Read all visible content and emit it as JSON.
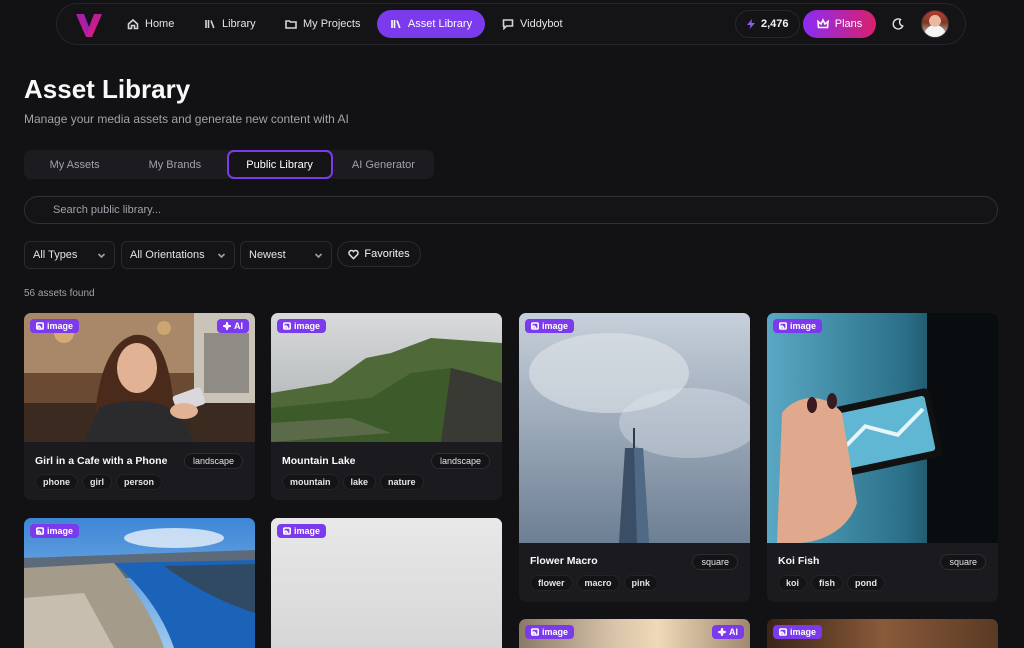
{
  "nav": {
    "items": [
      {
        "label": "Home",
        "icon": "home-icon"
      },
      {
        "label": "Library",
        "icon": "library-icon"
      },
      {
        "label": "My Projects",
        "icon": "folder-icon"
      },
      {
        "label": "Asset Library",
        "icon": "library-icon"
      },
      {
        "label": "Viddybot",
        "icon": "chat-icon"
      }
    ],
    "active": "Asset Library",
    "credits": "2,476",
    "plans_label": "Plans",
    "accent": "#7c3aed"
  },
  "page": {
    "title": "Asset Library",
    "subtitle": "Manage your media assets and generate new content with AI"
  },
  "tabs": [
    {
      "label": "My Assets"
    },
    {
      "label": "My Brands"
    },
    {
      "label": "Public Library"
    },
    {
      "label": "AI Generator"
    }
  ],
  "active_tab": "Public Library",
  "search": {
    "placeholder": "Search public library...",
    "value": ""
  },
  "filters": {
    "type": "All Types",
    "orientation": "All Orientations",
    "sort": "Newest",
    "favorites_label": "Favorites"
  },
  "results": {
    "count_text": "56 assets found"
  },
  "cards": [
    {
      "title": "Girl in a Cafe with a Phone",
      "type": "image",
      "ai": "AI",
      "orientation": "landscape",
      "tags": [
        "phone",
        "girl",
        "person"
      ]
    },
    {
      "title": "Mountain Lake",
      "type": "image",
      "orientation": "landscape",
      "tags": [
        "mountain",
        "lake",
        "nature"
      ]
    },
    {
      "title": "Flower Macro",
      "type": "image",
      "orientation": "square",
      "tags": [
        "flower",
        "macro",
        "pink"
      ]
    },
    {
      "title": "Koi Fish",
      "type": "image",
      "orientation": "square",
      "tags": [
        "koi",
        "fish",
        "pond"
      ]
    },
    {
      "type": "image"
    },
    {
      "type": "image"
    },
    {
      "type": "image",
      "ai": "AI"
    },
    {
      "type": "image"
    }
  ]
}
